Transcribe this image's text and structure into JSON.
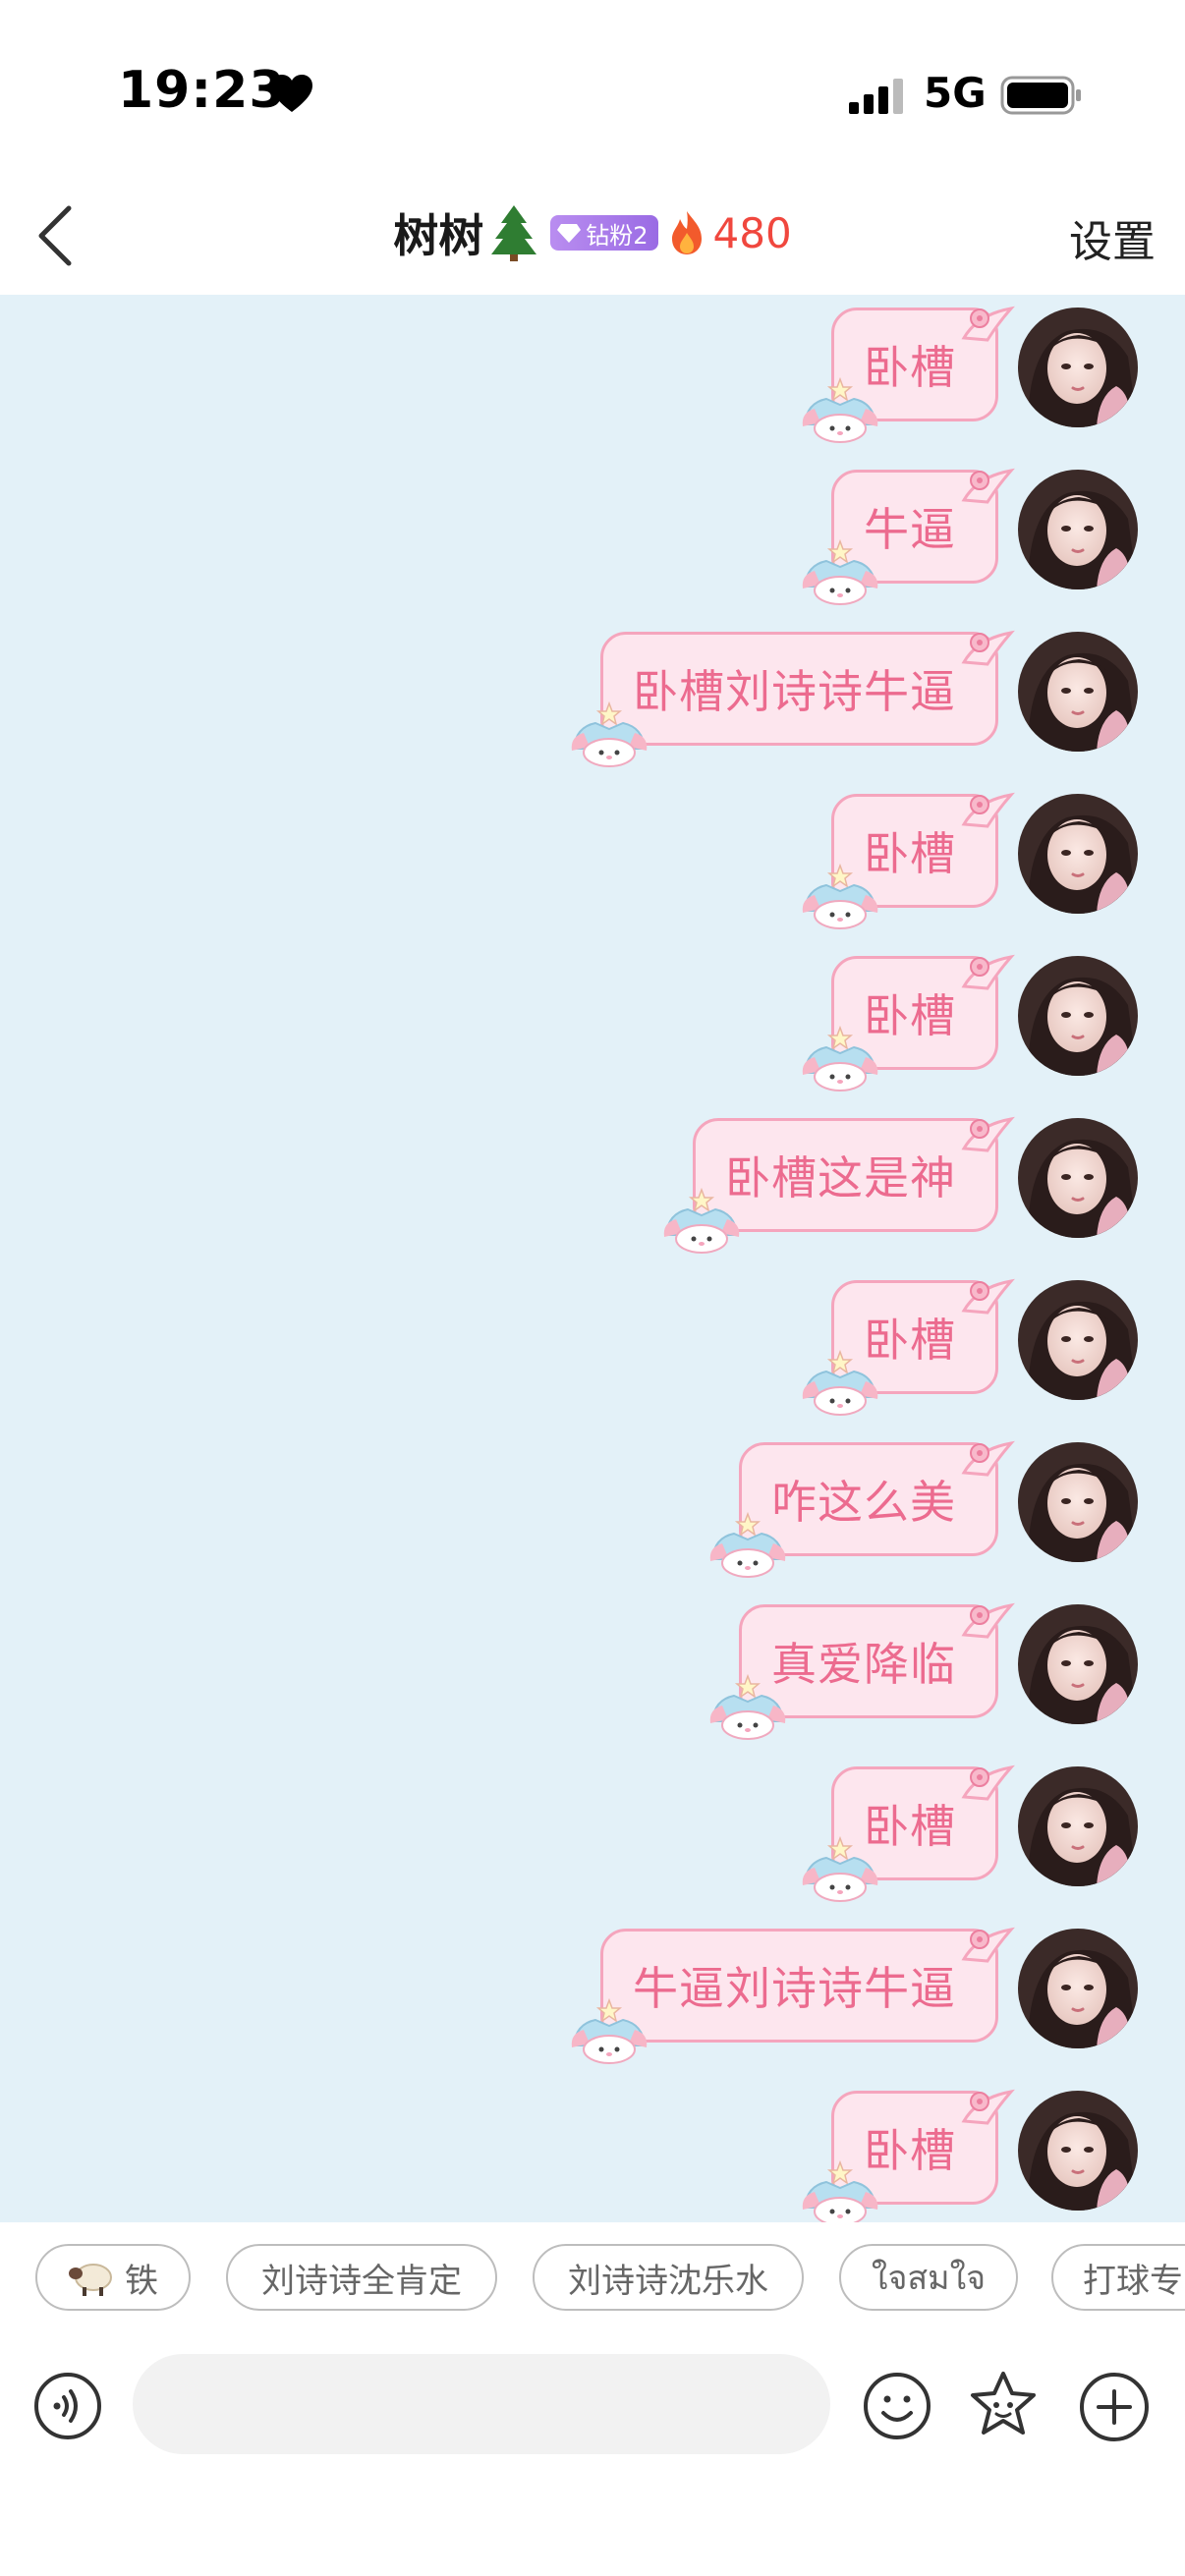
{
  "status_bar": {
    "time": "19:23",
    "network": "5G"
  },
  "header": {
    "title": "树树",
    "fan_badge": "钻粉2",
    "streak_count": "480",
    "settings_label": "设置"
  },
  "messages": [
    {
      "text": "卧槽"
    },
    {
      "text": "牛逼"
    },
    {
      "text": "卧槽刘诗诗牛逼"
    },
    {
      "text": "卧槽"
    },
    {
      "text": "卧槽"
    },
    {
      "text": "卧槽这是神"
    },
    {
      "text": "卧槽"
    },
    {
      "text": "咋这么美"
    },
    {
      "text": "真爱降临"
    },
    {
      "text": "卧槽"
    },
    {
      "text": "牛逼刘诗诗牛逼"
    },
    {
      "text": "卧槽"
    }
  ],
  "quick_replies": [
    "铁",
    "刘诗诗全肯定",
    "刘诗诗沈乐水",
    "ใจสมใจ",
    "打球专"
  ],
  "input": {
    "placeholder": ""
  },
  "colors": {
    "chat_bg": "#e3f1f8",
    "bubble_bg": "#fde6ee",
    "bubble_border": "#f5a5bd",
    "bubble_text": "#ec6b8f",
    "streak": "#f0473e"
  }
}
